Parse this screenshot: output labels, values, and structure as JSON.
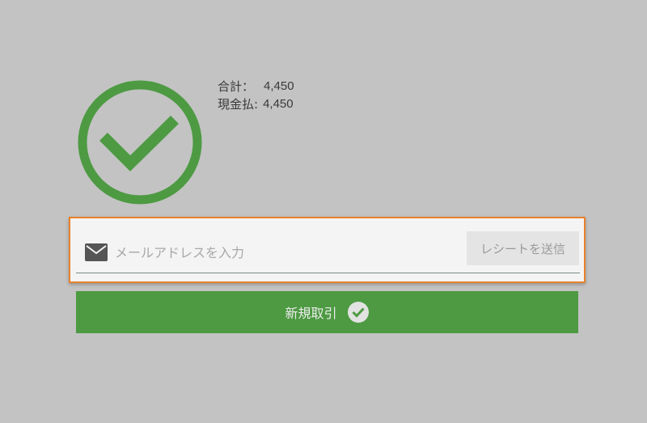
{
  "summary": {
    "total_label": "合計：",
    "total_value": "4,450",
    "cash_label": "現金払:",
    "cash_value": "4,450"
  },
  "email_receipt": {
    "placeholder": "メールアドレスを入力",
    "value": "",
    "send_label": "レシートを送信"
  },
  "new_transaction": {
    "label": "新規取引"
  },
  "colors": {
    "accent_green": "#4d9a42",
    "focus_orange": "#e8822c",
    "background": "#c3c3c3"
  },
  "icons": {
    "success": "check-circle-icon",
    "email": "mail-icon",
    "new_transaction": "check-circle-icon"
  }
}
